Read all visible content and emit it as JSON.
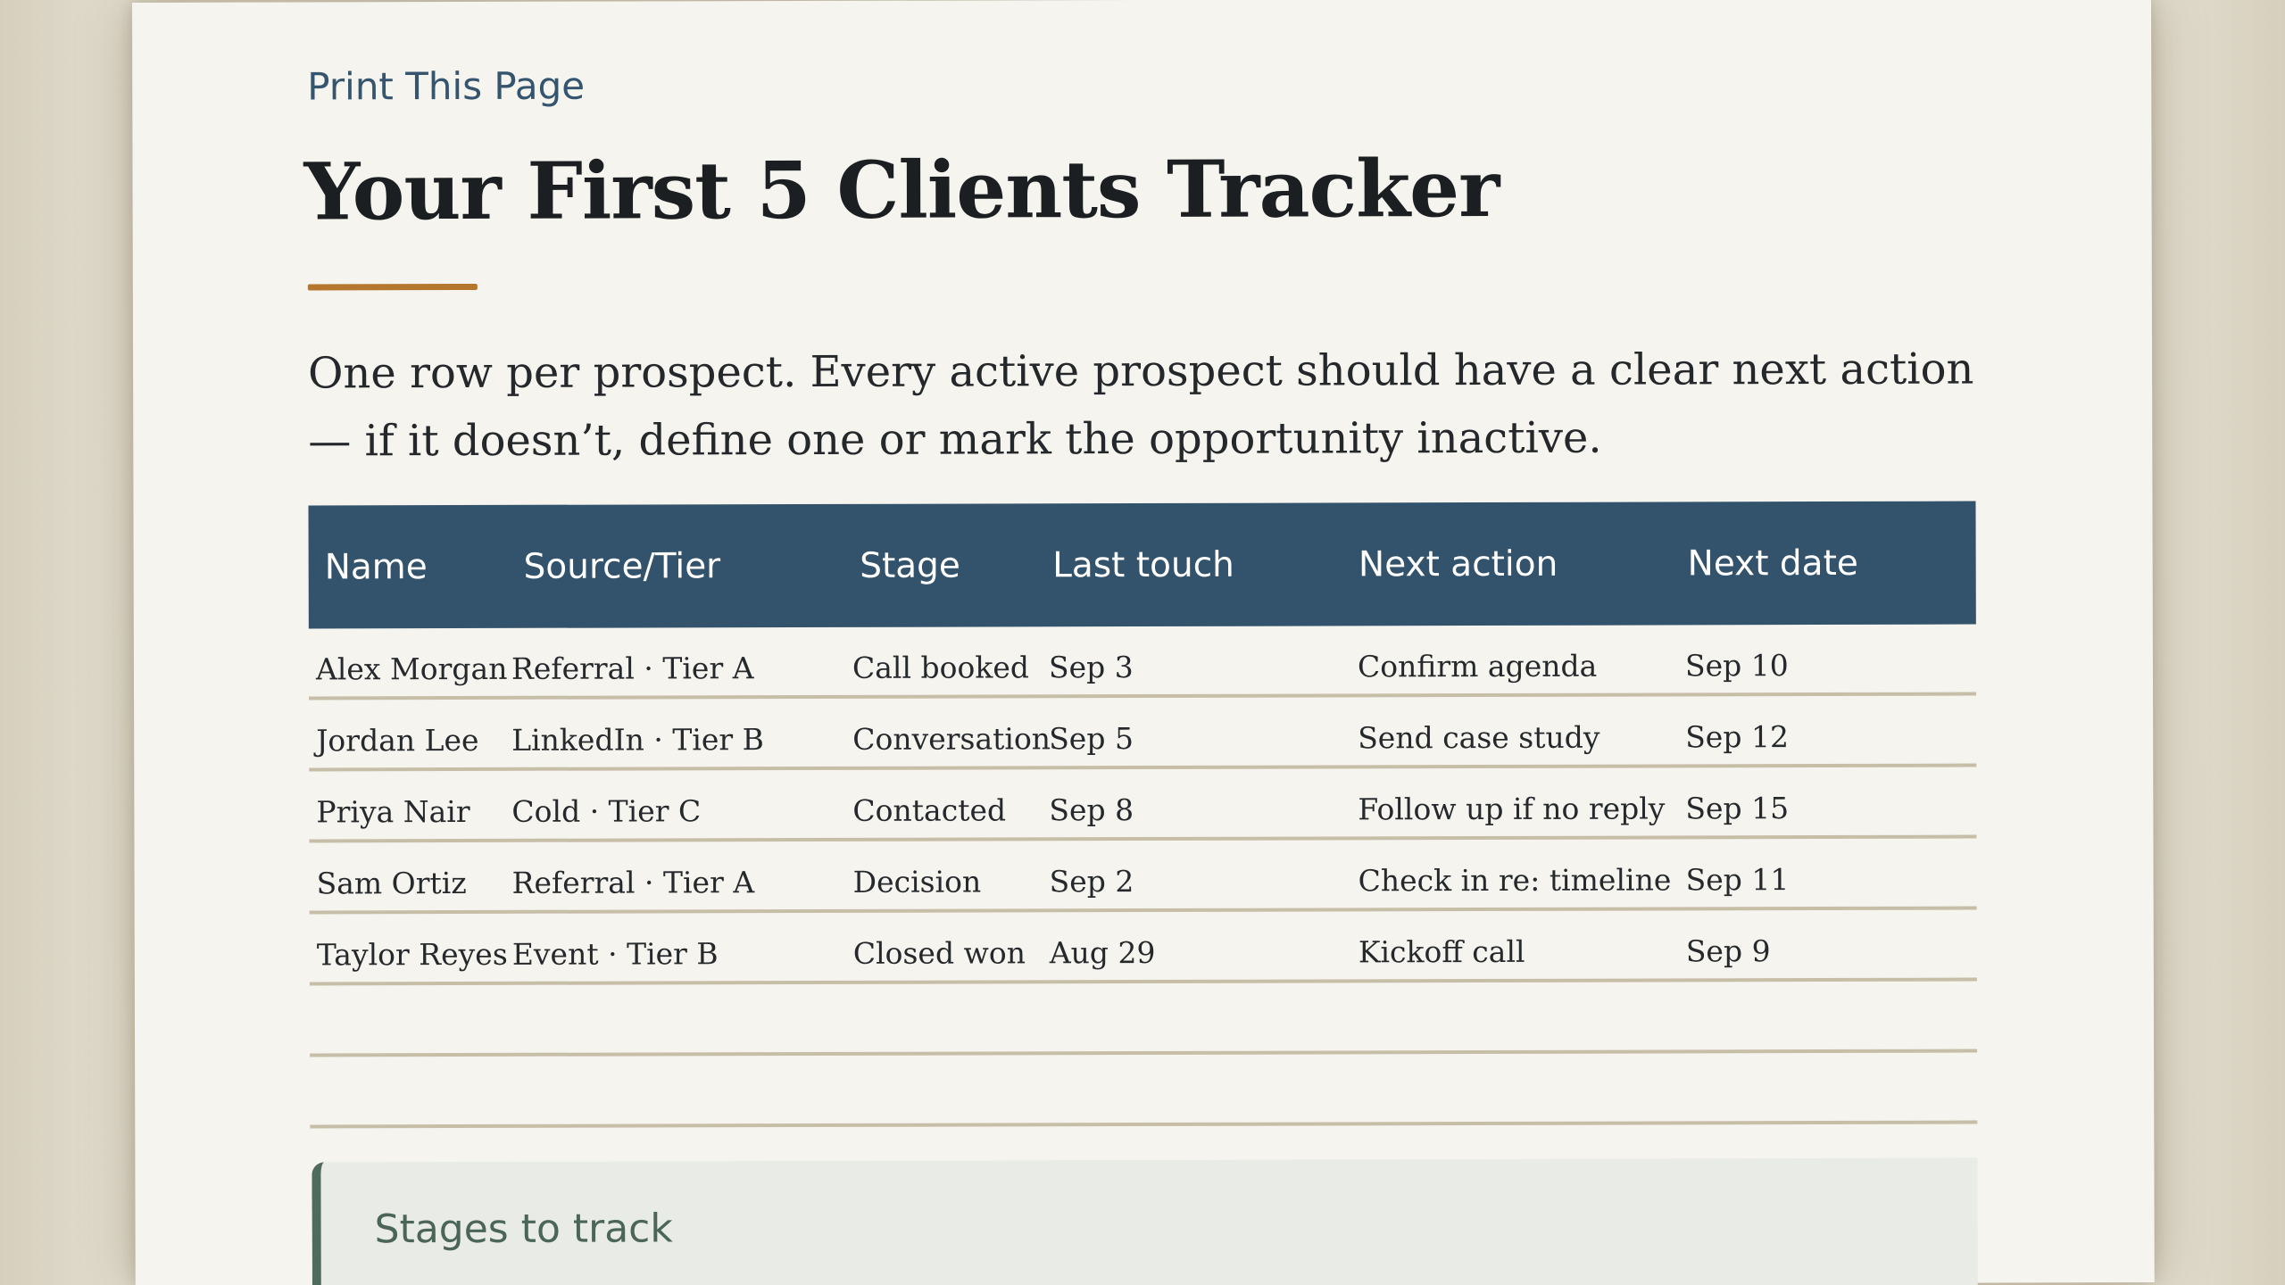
{
  "page": {
    "print_label": "Print This Page",
    "title": "Your First 5 Clients Tracker",
    "intro": "One row per prospect. Every active prospect should have a clear next action — if it doesn’t, define one or mark the opportunity inactive."
  },
  "table": {
    "headers": [
      "Name",
      "Source/Tier",
      "Stage",
      "Last touch",
      "Next action",
      "Next date"
    ],
    "rows": [
      [
        "Alex Morgan",
        "Referral · Tier A",
        "Call booked",
        "Sep 3",
        "Confirm agenda",
        "Sep 10"
      ],
      [
        "Jordan Lee",
        "LinkedIn · Tier B",
        "Conversation",
        "Sep 5",
        "Send case study",
        "Sep 12"
      ],
      [
        "Priya Nair",
        "Cold · Tier C",
        "Contacted",
        "Sep 8",
        "Follow up if no reply",
        "Sep 15"
      ],
      [
        "Sam Ortiz",
        "Referral · Tier A",
        "Decision",
        "Sep 2",
        "Check in re: timeline",
        "Sep 11"
      ],
      [
        "Taylor Reyes",
        "Event · Tier B",
        "Closed won",
        "Aug 29",
        "Kickoff call",
        "Sep 9"
      ]
    ]
  },
  "callout": {
    "title": "Stages to track",
    "text": ""
  },
  "colors": {
    "header_bg": "#33536c",
    "accent": "#b5772e",
    "paper": "#f5f4ef",
    "callout_border": "#4f6b5e"
  }
}
